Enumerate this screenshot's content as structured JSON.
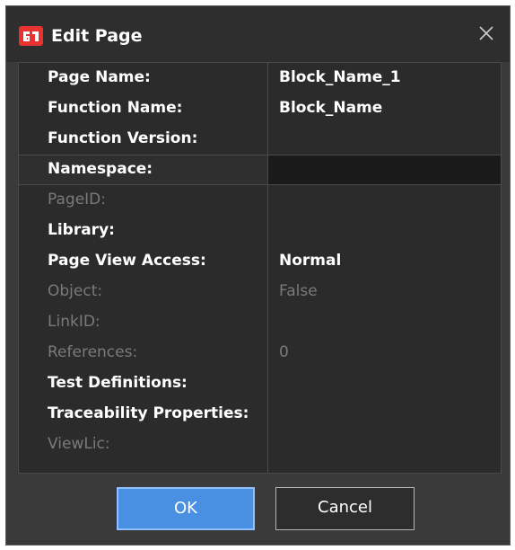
{
  "window": {
    "title": "Edit Page",
    "app_icon": "app-logo-icon",
    "close_icon": "close-icon"
  },
  "properties": [
    {
      "label": "Page Name:",
      "value": "Block_Name_1",
      "enabled": true
    },
    {
      "label": "Function Name:",
      "value": "Block_Name",
      "enabled": true
    },
    {
      "label": "Function Version:",
      "value": "",
      "enabled": true
    },
    {
      "label": "Namespace:",
      "value": "",
      "enabled": true,
      "selected": true
    },
    {
      "label": "PageID:",
      "value": "",
      "enabled": false
    },
    {
      "label": "Library:",
      "value": "",
      "enabled": true
    },
    {
      "label": "Page View Access:",
      "value": "Normal",
      "enabled": true
    },
    {
      "label": "Object:",
      "value": "False",
      "enabled": false
    },
    {
      "label": "LinkID:",
      "value": "",
      "enabled": false
    },
    {
      "label": "References:",
      "value": "0",
      "enabled": false
    },
    {
      "label": "Test Definitions:",
      "value": "",
      "enabled": true
    },
    {
      "label": "Traceability Properties:",
      "value": "",
      "enabled": true
    },
    {
      "label": "ViewLic:",
      "value": "",
      "enabled": false
    }
  ],
  "buttons": {
    "ok_label": "OK",
    "cancel_label": "Cancel"
  },
  "colors": {
    "accent": "#4a90e2",
    "app_icon": "#e8322f",
    "background": "#3a3a3a"
  }
}
